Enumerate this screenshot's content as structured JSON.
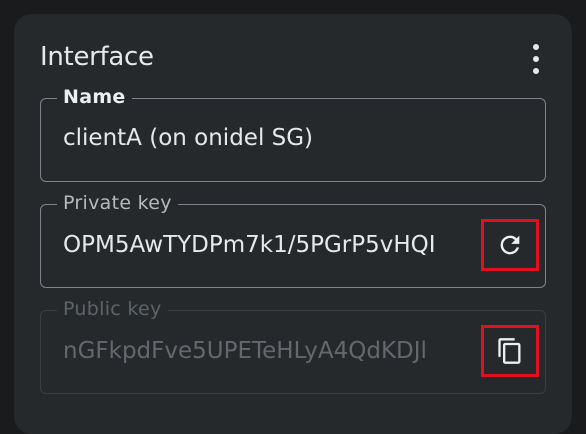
{
  "card": {
    "title": "Interface",
    "menu_icon": "more-vert-icon"
  },
  "fields": {
    "name": {
      "label": "Name",
      "value": "clientA (on onidel SG)"
    },
    "private_key": {
      "label": "Private key",
      "value": "OPM5AwTYDPm7k1/5PGrP5vHQI",
      "action_icon": "refresh-icon"
    },
    "public_key": {
      "label": "Public key",
      "value": "nGFkpdFve5UPETeHLyA4QdKDJl",
      "action_icon": "copy-icon"
    }
  },
  "colors": {
    "card_bg": "#26292b",
    "page_bg": "#1a1b1c",
    "text": "#e6e8ea",
    "highlight": "#e0101e"
  }
}
